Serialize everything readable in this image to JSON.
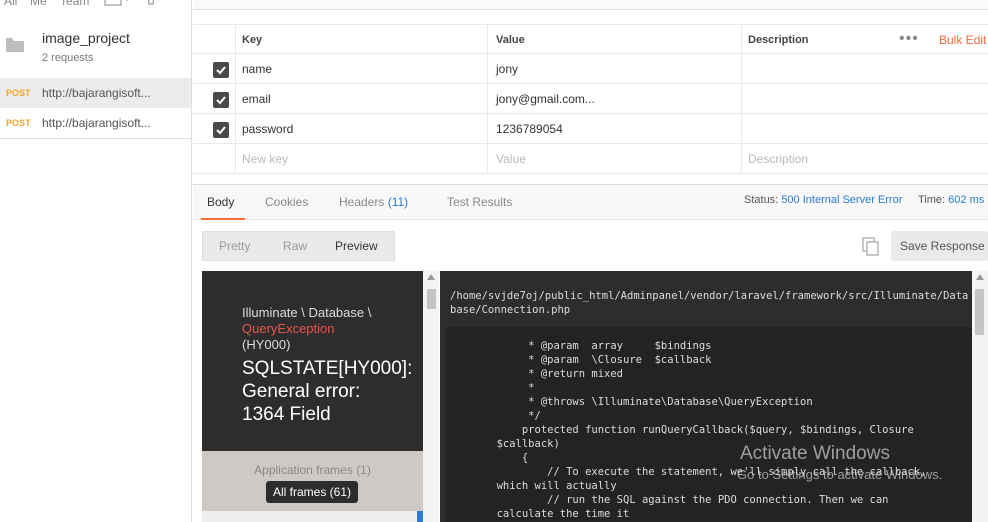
{
  "sidebar": {
    "top_items": [
      "All",
      "Me",
      "Team"
    ],
    "collection": {
      "name": "image_project",
      "subtitle": "2 requests"
    },
    "requests": [
      {
        "method": "POST",
        "url": "http://bajarangisoft..."
      },
      {
        "method": "POST",
        "url": "http://bajarangisoft..."
      }
    ]
  },
  "params": {
    "headers": {
      "key": "Key",
      "value": "Value",
      "description": "Description",
      "bulk_edit": "Bulk Edit"
    },
    "rows": [
      {
        "key": "name",
        "value": "jony",
        "checked": true
      },
      {
        "key": "email",
        "value": "jony@gmail.com...",
        "checked": true
      },
      {
        "key": "password",
        "value": "1236789054",
        "checked": true
      }
    ],
    "new_row": {
      "key": "New key",
      "value": "Value",
      "description": "Description"
    }
  },
  "response": {
    "tabs": {
      "body": "Body",
      "cookies": "Cookies",
      "headers": "Headers",
      "headers_count": "(11)",
      "test_results": "Test Results"
    },
    "status_label": "Status:",
    "status_value": "500 Internal Server Error",
    "time_label": "Time:",
    "time_value": "602 ms",
    "view_modes": {
      "pretty": "Pretty",
      "raw": "Raw",
      "preview": "Preview"
    },
    "save_response": "Save Response"
  },
  "preview": {
    "exception_namespace": "Illuminate \\ Database \\",
    "exception_type": "QueryException",
    "exception_code": "(HY000)",
    "exception_message": "SQLSTATE[HY000]: General error: 1364 Field",
    "application_frames": "Application frames (1)",
    "all_frames": "All frames (61)",
    "file_path": "/home/svjde7oj/public_html/Adminpanel/vendor/laravel/framework/src/Illuminate/Database/Connection.php",
    "code_lines": [
      "             * @param  array     $bindings",
      "             * @param  \\Closure  $callback",
      "             * @return mixed",
      "             *",
      "             * @throws \\Illuminate\\Database\\QueryException",
      "             */",
      "            protected function runQueryCallback($query, $bindings, Closure",
      "        $callback)",
      "            {",
      "                // To execute the statement, we'll simply call the callback,",
      "        which will actually",
      "                // run the SQL against the PDO connection. Then we can",
      "        calculate the time it"
    ]
  },
  "watermark": {
    "title": "Activate Windows",
    "subtitle": "Go to Settings to activate Windows."
  }
}
